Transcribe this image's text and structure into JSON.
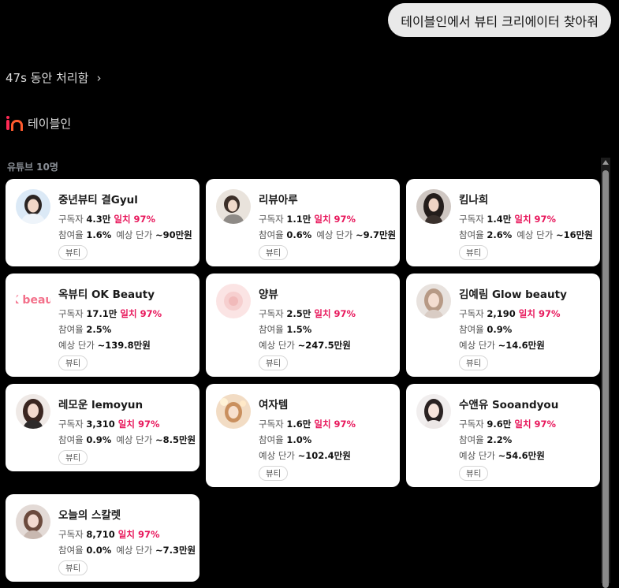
{
  "user_message": "테이블인에서 뷰티 크리에이터 찾아줘",
  "thinking": {
    "label": "47s 동안 처리함",
    "chevron": "›"
  },
  "source": {
    "name": "테이블인"
  },
  "section": {
    "label": "유튜브",
    "count": "10명"
  },
  "labels": {
    "subscribers": "구독자",
    "match": "일치",
    "engagement": "참여율",
    "est_price": "예상 단가"
  },
  "creators": [
    {
      "name": "중년뷰티 결Gyul",
      "subscribers": "4.3만",
      "match": "97%",
      "engagement": "1.6%",
      "price": "~90만원",
      "tag": "뷰티"
    },
    {
      "name": "리뷰아루",
      "subscribers": "1.1만",
      "match": "97%",
      "engagement": "0.6%",
      "price": "~9.7만원",
      "tag": "뷰티"
    },
    {
      "name": "킴나희",
      "subscribers": "1.4만",
      "match": "97%",
      "engagement": "2.6%",
      "price": "~16만원",
      "tag": "뷰티"
    },
    {
      "name": "옥뷰티 OK Beauty",
      "subscribers": "17.1만",
      "match": "97%",
      "engagement": "2.5%",
      "price": "~139.8만원",
      "tag": "뷰티"
    },
    {
      "name": "양뷰",
      "subscribers": "2.5만",
      "match": "97%",
      "engagement": "1.5%",
      "price": "~247.5만원",
      "tag": "뷰티"
    },
    {
      "name": "김예림 Glow beauty",
      "subscribers": "2,190",
      "match": "97%",
      "engagement": "0.9%",
      "price": "~14.6만원",
      "tag": "뷰티"
    },
    {
      "name": "레모운 lemoyun",
      "subscribers": "3,310",
      "match": "97%",
      "engagement": "0.9%",
      "price": "~8.5만원",
      "tag": "뷰티"
    },
    {
      "name": "여자템",
      "subscribers": "1.6만",
      "match": "97%",
      "engagement": "1.0%",
      "price": "~102.4만원",
      "tag": "뷰티"
    },
    {
      "name": "수앤유 Sooandyou",
      "subscribers": "9.6만",
      "match": "97%",
      "engagement": "2.2%",
      "price": "~54.6만원",
      "tag": "뷰티"
    },
    {
      "name": "오늘의 스칼렛",
      "subscribers": "8,710",
      "match": "97%",
      "engagement": "0.0%",
      "price": "~7.3만원",
      "tag": "뷰티"
    }
  ],
  "ok_logo_text": "OK beauty"
}
